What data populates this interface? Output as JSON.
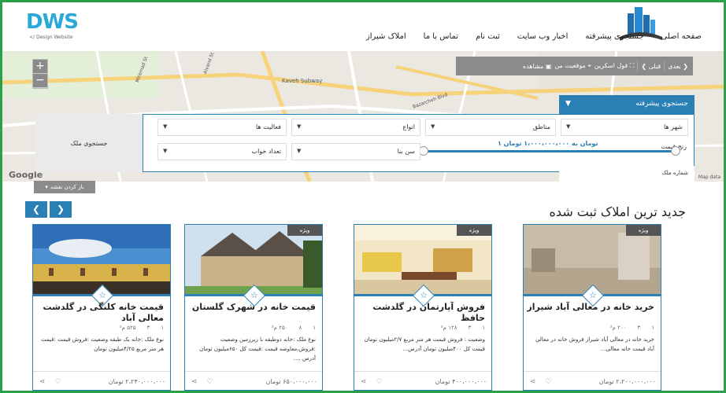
{
  "header": {
    "logo_text": "DWS",
    "logo_sub": "</ Design Website",
    "nav": [
      "صفحه اصلی",
      "جستجوی پیشرفته",
      "اخبار وب سایت",
      "ثبت نام",
      "تماس با ما",
      "املاک شیراز"
    ]
  },
  "map": {
    "toolbar": [
      "بعدی",
      "قبلی",
      "فول اسکرین",
      "موقعیت من",
      "مشاهده"
    ],
    "google": "Google",
    "map_data": "Map data",
    "close_label": "باز کردن نقشه",
    "street_labels": [
      "Kaveh Subway",
      "Alvand St",
      "Miremad St",
      "Bazarcheh Blvd"
    ]
  },
  "search": {
    "tab_label": "جستجوی پیشرفته",
    "button_label": "جستجوی ملک",
    "selects_row1": [
      "شهر ها",
      "مناطق",
      "انواع",
      "فعالیت ها"
    ],
    "selects_row2": [
      "سن بنا",
      "تعداد خواب"
    ],
    "price_label": "رنج قیمت",
    "price_value": "تومان به ۱،۰۰۰،۰۰۰،۰۰۰ تومان ۱",
    "plot_label": "شماره ملک"
  },
  "listing": {
    "title": "جدید ترین املاک ثبت شده",
    "cards": [
      {
        "badge": "ویژه",
        "title": "خرید خانه در معالی آباد شیراز",
        "meta": [
          "۱",
          "۳",
          "۲۰۰ م²"
        ],
        "desc": "خرید خانه در معالی آباد شیراز فروش خانه در معالی آباد قیمت خانه معالی...",
        "price": "۲،۲۰۰،۰۰۰،۰۰۰ تومان"
      },
      {
        "badge": "ویژه",
        "title": "فروش آپارتمان در گلدشت حافظ",
        "meta": [
          "۱",
          "۳",
          "۱۲۸ م²"
        ],
        "desc": "وضعیت : فروش قیمت هر متر مربع ۲/۷میلیون تومان قیمت کل ۴۰۰میلیون تومان آدرس...",
        "price": "۴۰۰،۰۰۰،۰۰۰ تومان"
      },
      {
        "badge": "ویژه",
        "title": "قیمت خانه در شهرک گلستان",
        "meta": [
          "۱",
          "۸",
          "۲۵۰ م²"
        ],
        "desc": "نوع ملک :خانه دوطبقه با زیرزمین وضعیت :فروش،معاوضه قیمت :قیمت کل ۶۵۰میلیون تومان آدرس ....",
        "price": "۶۵۰،۰۰۰،۰۰۰ تومان"
      },
      {
        "badge": "",
        "title": "قیمت خانه کلنگی در گلدشت معالی آباد",
        "meta": [
          "۱",
          "۳",
          "۵۲۵ م²"
        ],
        "desc": "نوع ملک :خانه یک طبقه وضعیت :فروش قیمت :قیمت هر متر مربع ۴/۲۵میلیون تومان",
        "price": "۲،۲۴۰،۰۰۰،۰۰۰ تومان"
      }
    ]
  },
  "colors": {
    "accent": "#2a7fb5",
    "frame": "#2aa048"
  }
}
